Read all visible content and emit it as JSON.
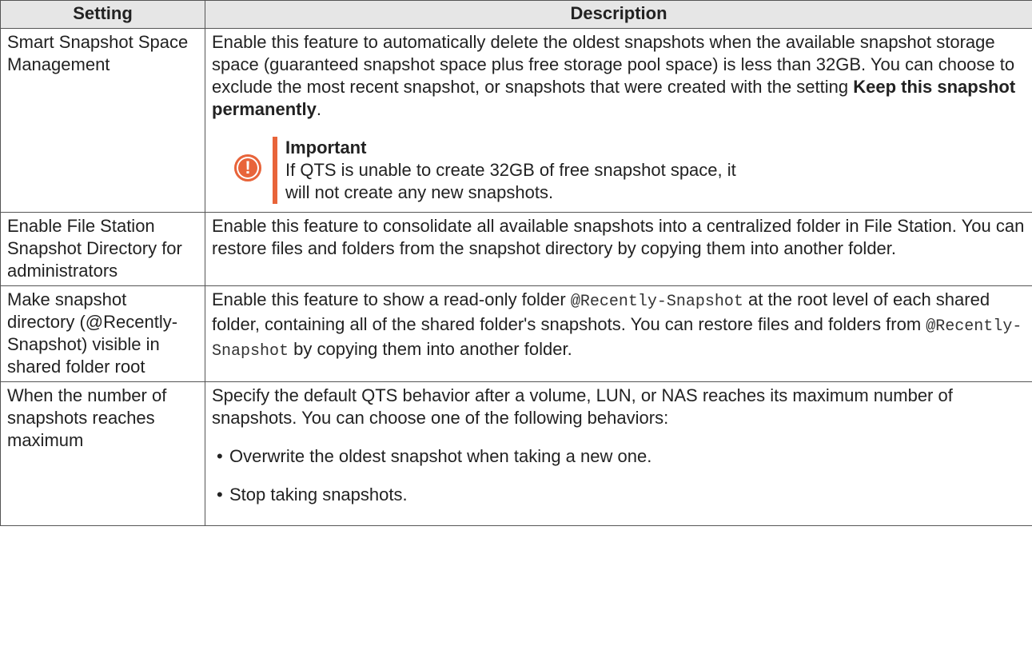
{
  "table": {
    "headers": {
      "setting": "Setting",
      "description": "Description"
    },
    "rows": [
      {
        "setting": "Smart Snapshot Space Management",
        "description": {
          "text": "Enable this feature to automatically delete the oldest snapshots when the available snapshot storage space (guaranteed snapshot space plus free storage pool space) is less than 32GB. You can choose to exclude the most recent snapshot, or snapshots that were created with the setting ",
          "bold": "Keep this snapshot permanently",
          "end": "."
        },
        "note": {
          "icon": "exclamation-icon",
          "icon_glyph": "!",
          "title": "Important",
          "text": "If QTS is unable to create 32GB of free snapshot space, it will not create any new snapshots."
        }
      },
      {
        "setting": "Enable File Station Snapshot Directory for administrators",
        "description": {
          "text": "Enable this feature to consolidate all available snapshots into a centralized folder in File Station. You can restore files and folders from the snapshot directory by copying them into another folder."
        }
      },
      {
        "setting": "Make snapshot directory (@Recently-Snapshot) visible in shared folder root",
        "description": {
          "part1": "Enable this feature to show a read-only folder ",
          "code1": "@Recently-Snapshot",
          "part2": " at the root level of each shared folder, containing all of the shared folder's snapshots. You can restore files and folders from ",
          "code2": "@Recently-Snapshot",
          "part3": " by copying them into another folder."
        }
      },
      {
        "setting": "When the number of snapshots reaches maximum",
        "description": {
          "text": "Specify the default QTS behavior after a volume, LUN, or NAS reaches its maximum number of snapshots. You can choose one of the following behaviors:"
        },
        "options": [
          "Overwrite the oldest snapshot when taking a new one.",
          "Stop taking snapshots."
        ]
      }
    ]
  },
  "colors": {
    "header_bg": "#e6e6e6",
    "border": "#555555",
    "note_accent": "#e8643a"
  }
}
